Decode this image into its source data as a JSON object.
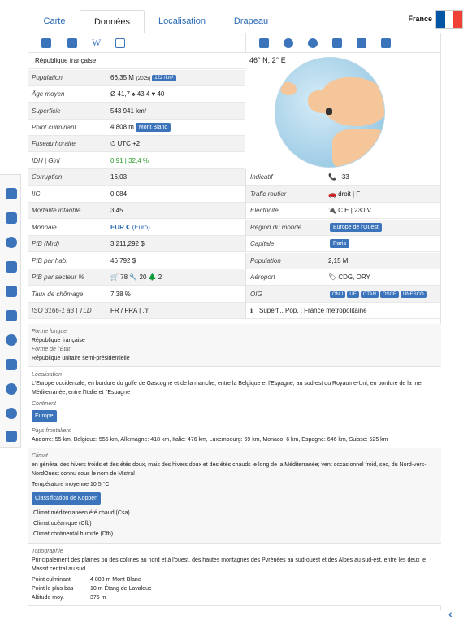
{
  "tabs": [
    "Carte",
    "Données",
    "Localisation",
    "Drapeau"
  ],
  "country": "France",
  "flag_colors": [
    "#0055A4",
    "#FFFFFF",
    "#EF4135"
  ],
  "left_rows": [
    {
      "label": "",
      "value": "République française"
    },
    {
      "label": "Population",
      "value": "66,35 M",
      "extra": "(2025)",
      "badge": "122 /km²"
    },
    {
      "label": "Âge moyen",
      "value": "Ø 41,7  ♠ 43,4  ♥ 40"
    },
    {
      "label": "Superficie",
      "value": "543 941 km²"
    },
    {
      "label": "Point culminant",
      "value": "4 808 m",
      "badge": "Mont Blanc"
    },
    {
      "label": "Fuseau horaire",
      "value": "⏱ UTC +2"
    },
    {
      "label": "IDH | Gini",
      "value": "0,91 | 32,4 %"
    },
    {
      "label": "Corruption",
      "value": "16,03"
    },
    {
      "label": "IIG",
      "value": "0,084"
    },
    {
      "label": "Mortalité infantile",
      "value": "3,45"
    },
    {
      "label": "Monnaie",
      "value": "EUR €",
      "extra": "(Euro)"
    },
    {
      "label": "PIB (Mrd)",
      "value": "3 211,292 $"
    },
    {
      "label": "PIB par hab.",
      "value": "46 792 $"
    },
    {
      "label": "PIB par secteur %",
      "value": "🛒 78  🔧 20  🌲 2"
    },
    {
      "label": "Taux de chômage",
      "value": "7,38 %"
    },
    {
      "label": "ISO 3166-1 a3 | TLD",
      "value": "FR / FRA  |  .fr"
    }
  ],
  "coords": "46° N, 2° E",
  "right_rows": [
    {
      "label": "Indicatif",
      "value": "📞 +33"
    },
    {
      "label": "Trafic routier",
      "value": "🚗 droit | F"
    },
    {
      "label": "Electricité",
      "value": "🔌 C,E | 230 V"
    },
    {
      "label": "Région du monde",
      "badge": "Europe de l'Ouest"
    },
    {
      "label": "Capitale",
      "badge": "Paris"
    },
    {
      "label": "Population",
      "value": "2,15 M"
    },
    {
      "label": "Aéroport",
      "value": "🏷 CDG, ORY"
    },
    {
      "label": "OIG",
      "badges": [
        "ONU",
        "UE",
        "OTAN",
        "OSCE",
        "UNESCO"
      ]
    },
    {
      "label": "ℹ",
      "value": "Superfi., Pop. : France métropolitaine"
    }
  ],
  "forme_longue_label": "Forme longue",
  "forme_longue": "République française",
  "forme_etat_label": "Forme de l'État",
  "forme_etat": "République unitaire semi-présidentielle",
  "localisation_label": "Localisation",
  "localisation": "L'Europe occidentale, en bordure du golfe de Gascogne et de la manche, entre la Belgique et l'Espagne, au sud-est du Royaume-Uni; en bordure de la mer Méditerranée, entre l'Italie et l'Espagne",
  "continent_label": "Continent",
  "continent": "Europe",
  "frontaliers_label": "Pays frontaliers",
  "frontaliers": "Andorre: 55 km, Belgique: 556 km, Allemagne: 418 km, Italie: 476 km, Luxembourg: 69 km, Monaco: 6 km, Espagne: 646 km, Suisse: 525 km",
  "climat_label": "Climat",
  "climat": "en général des hivers froids et des étés doux, mais des hivers doux et des étés chauds le long de la Méditerranée; vent occasionnel froid, sec, du Nord-vers-NordOuest connu sous le nom de Mistral",
  "temperature": "Température moyenne   10,5 °C",
  "koppen": "Classification de Köppen",
  "climats": [
    "Climat méditerranéen été chaud (Csa)",
    "Climat océanique (Cfb)",
    "Climat continental humide (Dfb)"
  ],
  "topo_label": "Topographie",
  "topo": "Principalement des plaines ou des collines au nord et à l'ouest, des hautes montagnes des Pyrénées au sud-ouest et des Alpes au sud-est, entre les deux le Massif central au sud.",
  "points": [
    {
      "k": "Point culminant",
      "v": "4 808 m Mont Blanc"
    },
    {
      "k": "Point le plus bas",
      "v": "10 m Étang de Lavalduc"
    },
    {
      "k": "Altitude moy.",
      "v": "375 m"
    }
  ]
}
